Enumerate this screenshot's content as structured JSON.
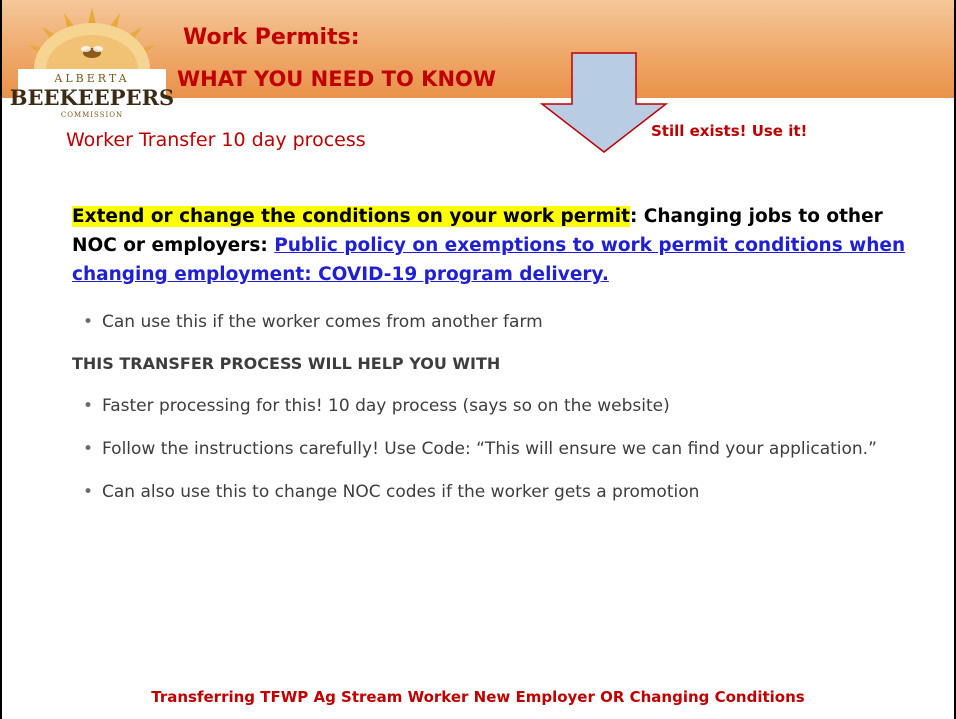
{
  "logo": {
    "top_text": "ALBERTA",
    "main_text": "BEEKEEPERS",
    "bottom_text": "COMMISSION"
  },
  "header": {
    "title_line1": "Work Permits:",
    "title_line2": "WHAT YOU NEED TO KNOW"
  },
  "subtitle": "Worker Transfer 10 day process",
  "callout": "Still exists!  Use it!",
  "lead": {
    "highlight": "Extend or change the conditions on your work permit",
    "middle": ": Changing jobs to other NOC or employers: ",
    "link": "Public policy on exemptions to work permit conditions when changing employment: COVID-19 program delivery."
  },
  "bullet1": "Can use this if the worker comes from another farm",
  "section_heading": "THIS TRANSFER PROCESS WILL HELP YOU WITH",
  "bullets": [
    "Faster processing for this! 10 day process (says so on the website)",
    "Follow the instructions carefully! Use Code: “This will ensure we can find your application.”",
    "Can also use this to change NOC codes if the worker gets a promotion"
  ],
  "footer": "Transferring TFWP Ag Stream Worker New Employer OR Changing Conditions",
  "colors": {
    "accent_red": "#c00000",
    "link_blue": "#1f1fd6",
    "highlight": "#ffff00",
    "banner": "#efa96a",
    "arrow_fill": "#b8cce4"
  },
  "icons": {
    "logo": "alberta-beekeepers-logo",
    "arrow": "down-arrow-icon"
  }
}
